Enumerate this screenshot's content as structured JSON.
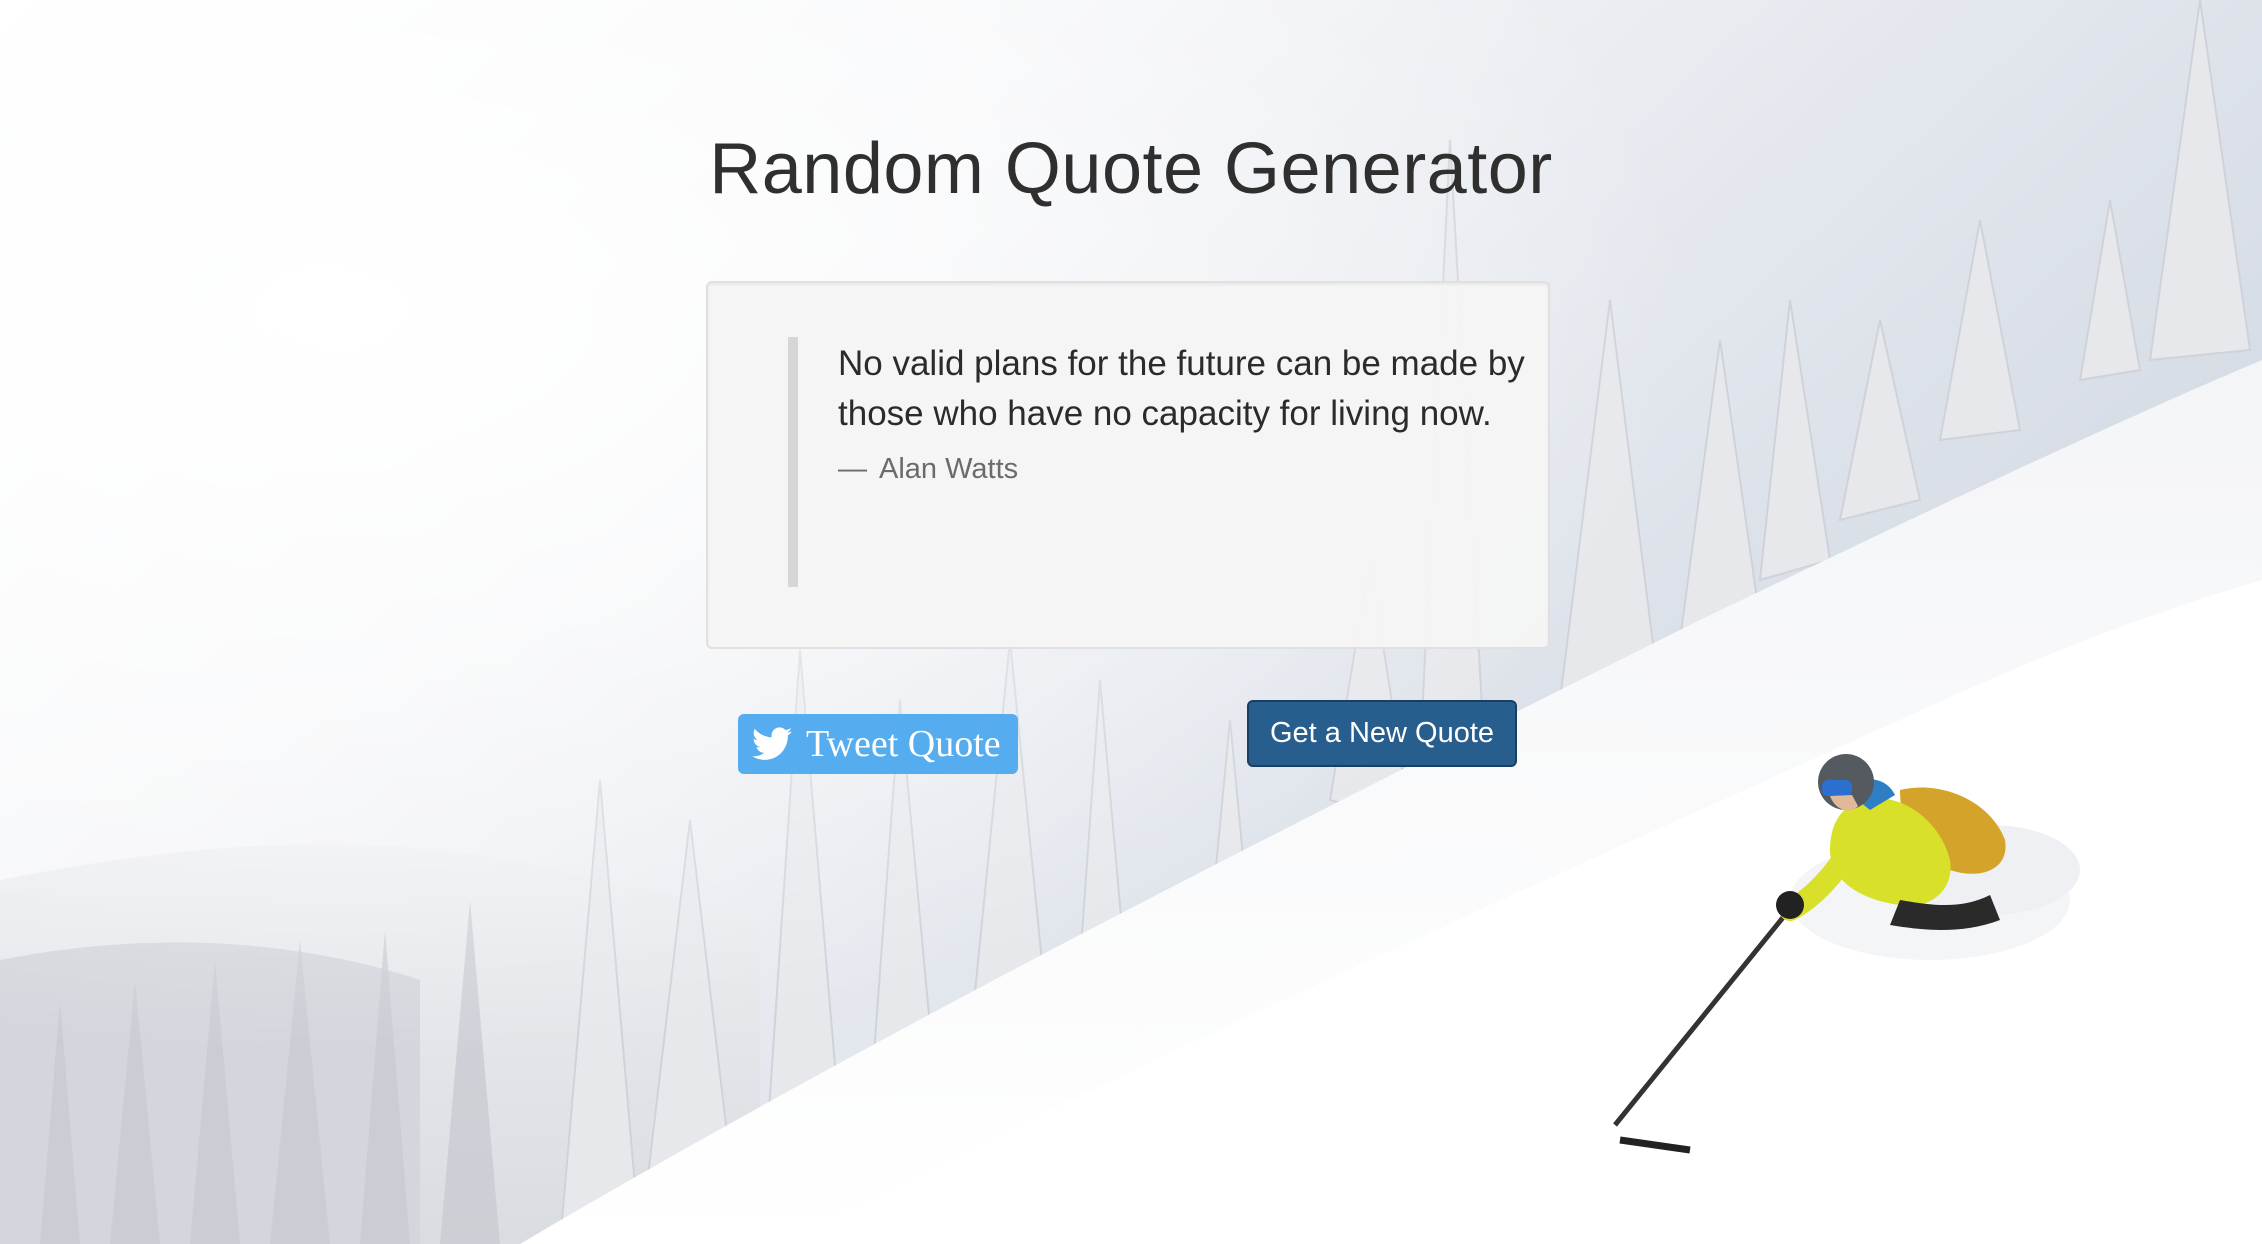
{
  "page": {
    "title": "Random Quote Generator"
  },
  "quote": {
    "text": "No valid plans for the future can be made by those who have no capacity for living now.",
    "author_dash": "—",
    "author": "Alan Watts"
  },
  "actions": {
    "tweet_label": "Tweet Quote",
    "new_quote_label": "Get a New Quote"
  },
  "icons": {
    "tweet": "twitter-bird-icon"
  },
  "colors": {
    "tweet_button": "#55acee",
    "new_quote_button": "#285e8e",
    "title": "#2f2f2f"
  }
}
